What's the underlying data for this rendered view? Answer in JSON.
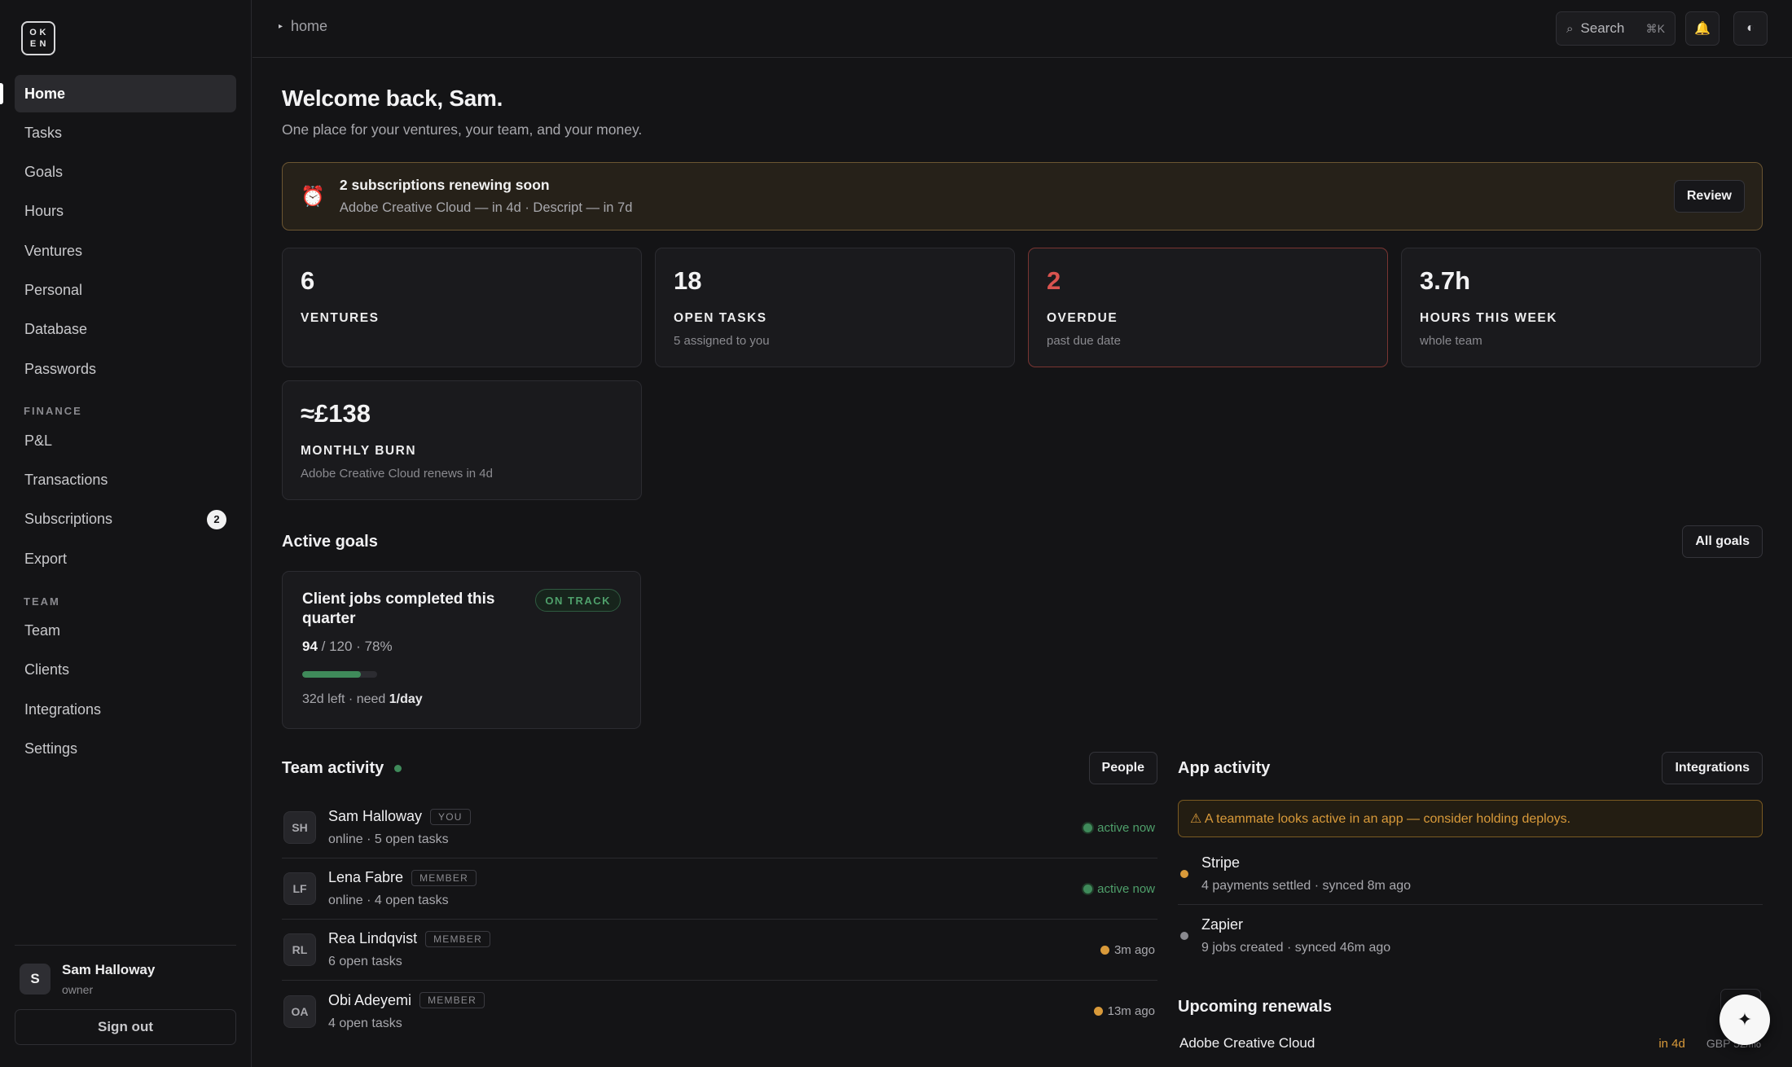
{
  "app": {
    "logo_letters": [
      "O",
      "K",
      "E",
      "N"
    ]
  },
  "sidebar": {
    "items": [
      {
        "label": "Home",
        "active": true
      },
      {
        "label": "Tasks"
      },
      {
        "label": "Goals"
      },
      {
        "label": "Hours"
      },
      {
        "label": "Ventures"
      },
      {
        "label": "Personal"
      },
      {
        "label": "Database"
      },
      {
        "label": "Passwords"
      }
    ],
    "finance_heading": "FINANCE",
    "finance_items": [
      {
        "label": "P&L"
      },
      {
        "label": "Transactions"
      },
      {
        "label": "Subscriptions",
        "badge": "2"
      },
      {
        "label": "Export"
      }
    ],
    "team_heading": "TEAM",
    "team_items": [
      {
        "label": "Team"
      },
      {
        "label": "Clients"
      },
      {
        "label": "Integrations"
      },
      {
        "label": "Settings"
      }
    ],
    "user": {
      "initial": "S",
      "name": "Sam Halloway",
      "role": "owner"
    },
    "signout_label": "Sign out"
  },
  "topbar": {
    "breadcrumb": "home",
    "search_label": "Search",
    "search_shortcut": "⌘K"
  },
  "main": {
    "welcome": "Welcome back, Sam.",
    "subtitle": "One place for your ventures, your team, and your money.",
    "alert": {
      "title": "2 subscriptions renewing soon",
      "detail": "Adobe Creative Cloud — in 4d · Descript — in 7d",
      "button": "Review"
    },
    "stats": [
      {
        "value": "6",
        "label": "VENTURES",
        "sub": ""
      },
      {
        "value": "18",
        "label": "OPEN TASKS",
        "sub": "5 assigned to you"
      },
      {
        "value": "2",
        "label": "OVERDUE",
        "sub": "past due date"
      },
      {
        "value": "3.7h",
        "label": "HOURS THIS WEEK",
        "sub": "whole team"
      },
      {
        "value": "≈£138",
        "label": "MONTHLY BURN",
        "sub": "Adobe Creative Cloud renews in 4d"
      }
    ],
    "goals": {
      "title": "Active goals",
      "button": "All goals",
      "card": {
        "title": "Client jobs completed this quarter",
        "badge": "ON TRACK",
        "done": "94",
        "rest": " / 120 · 78%",
        "progress": 0.78,
        "foot_left": "32d left · need ",
        "foot_rate": "1/day"
      }
    }
  },
  "team_activity": {
    "title": "Team activity",
    "button": "People",
    "members": [
      {
        "initials": "SH",
        "name": "Sam Halloway",
        "role": "YOU",
        "sub": "online · 5 open tasks",
        "status": "active now",
        "status_color": "#4fa06b"
      },
      {
        "initials": "LF",
        "name": "Lena Fabre",
        "role": "MEMBER",
        "sub": "online · 4 open tasks",
        "status": "active now",
        "status_color": "#4fa06b"
      },
      {
        "initials": "RL",
        "name": "Rea Lindqvist",
        "role": "MEMBER",
        "sub": "6 open tasks",
        "status": "3m ago",
        "status_color": "#a8a8ad"
      },
      {
        "initials": "OA",
        "name": "Obi Adeyemi",
        "role": "MEMBER",
        "sub": "4 open tasks",
        "status": "13m ago",
        "status_color": "#a8a8ad"
      }
    ]
  },
  "app_activity": {
    "title": "App activity",
    "button": "Integrations",
    "warning": "⚠ A teammate looks active in an app — consider holding deploys.",
    "apps": [
      {
        "name": "Stripe",
        "sub": "4 payments settled · synced 8m ago"
      },
      {
        "name": "Zapier",
        "sub": "9 jobs created · synced 46m ago"
      }
    ]
  },
  "renewals": {
    "title": "Upcoming renewals",
    "items": [
      {
        "name": "Adobe Creative Cloud",
        "when": "in 4d",
        "price": "GBP 52",
        "period": "/mo"
      }
    ]
  },
  "colors": {
    "background": "#141416",
    "accent_green": "#3f8a5a",
    "danger": "#d9534f",
    "amber": "#d99a3a"
  },
  "icons": {
    "alert": "alarm-clock-icon",
    "search": "search-icon",
    "bell": "bell-icon",
    "theme": "contrast-icon",
    "fab": "sparkle-icon"
  }
}
